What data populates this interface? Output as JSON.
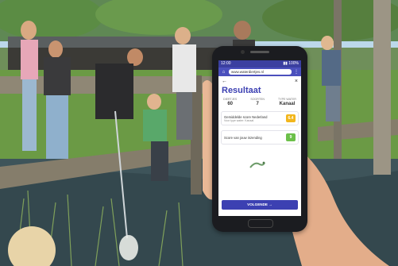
{
  "phone_ui": {
    "status_time": "12:00",
    "status_icons": "▮▮ 100%",
    "url": "www.waterdiertjes.nl",
    "back_arrow": "←",
    "close_x": "×",
    "title": "Resultaat",
    "stats": [
      {
        "label": "Diertjes",
        "value": "60"
      },
      {
        "label": "Soorten",
        "value": "7"
      },
      {
        "label": "Type water",
        "value": "Kanaal"
      }
    ],
    "card1": {
      "text": "Gemiddelde score Nederland",
      "sub": "Voor type water: Kanaal",
      "score": "6.4",
      "color": "#f2b61c"
    },
    "card2": {
      "text": "Score van jouw inzending",
      "score": "9",
      "color": "#6cc04a"
    },
    "cta_label": "VOLGENDE  →"
  },
  "colors": {
    "accent": "#3c40b2",
    "sky": "#cfe3f0",
    "grass": "#5f8a3e",
    "water": "#415a63",
    "wood": "#8f8775"
  }
}
